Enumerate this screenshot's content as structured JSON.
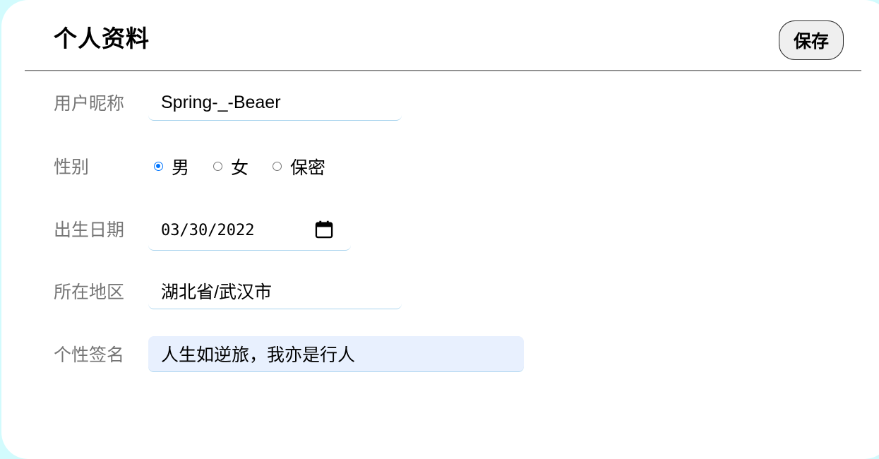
{
  "header": {
    "title": "个人资料",
    "save_label": "保存"
  },
  "form": {
    "nickname": {
      "label": "用户昵称",
      "value": "Spring-_-Beaer"
    },
    "gender": {
      "label": "性别",
      "options": [
        "男",
        "女",
        "保密"
      ],
      "selected": "男"
    },
    "birthday": {
      "label": "出生日期",
      "value": "03/30/2022",
      "icon": "calendar-icon"
    },
    "region": {
      "label": "所在地区",
      "value": "湖北省/武汉市"
    },
    "signature": {
      "label": "个性签名",
      "value": "人生如逆旅，我亦是行人"
    }
  },
  "colors": {
    "page_background": "#d2fbfd",
    "card_background": "#ffffff",
    "label_text": "#757575",
    "radio_accent": "#0075ff",
    "input_underline": "#a9d4ee",
    "autofill_background": "#e8f0fe"
  }
}
